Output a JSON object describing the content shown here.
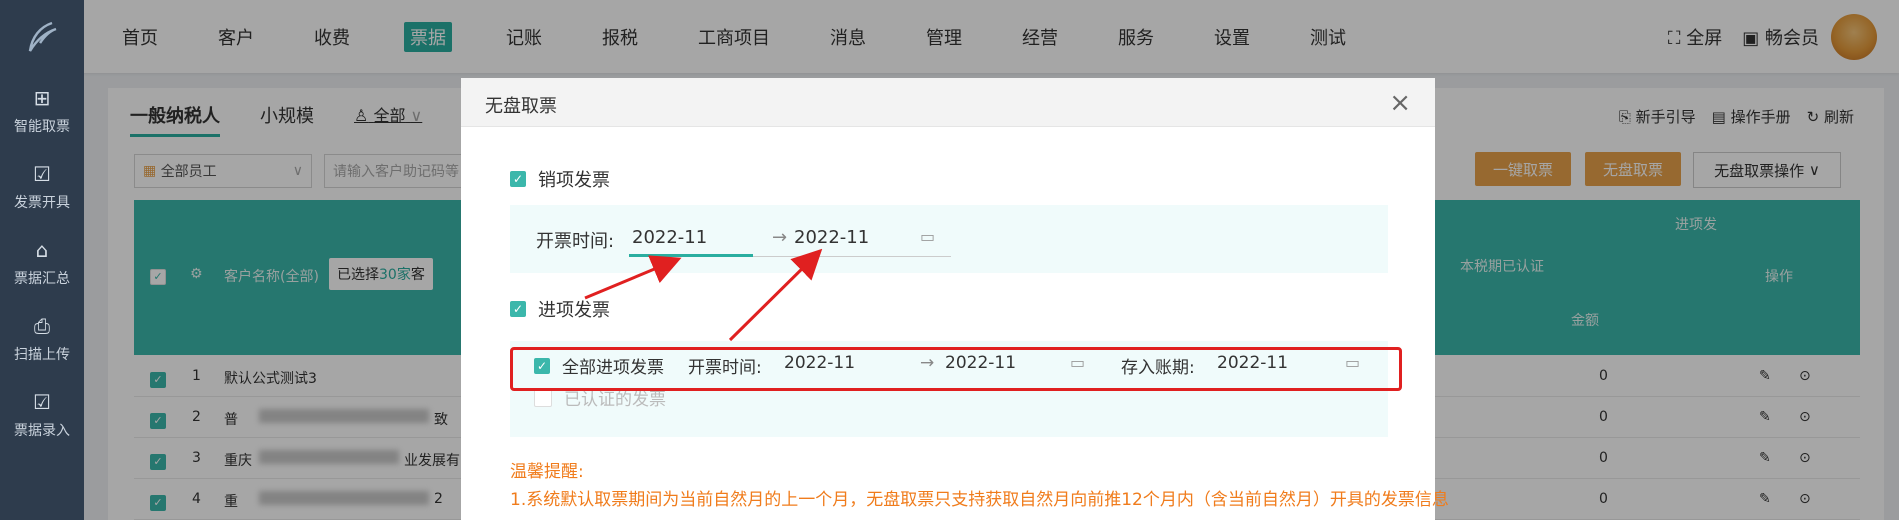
{
  "nav": {
    "items": [
      "首页",
      "客户",
      "收费",
      "票据",
      "记账",
      "报税",
      "工商项目",
      "消息",
      "管理",
      "经营",
      "服务",
      "设置",
      "测试"
    ],
    "active": "票据",
    "fullscreen": "全屏",
    "member": "畅会员"
  },
  "sidebar": {
    "items": [
      {
        "label": "智能取票",
        "icon": "smart-ticket-icon"
      },
      {
        "label": "发票开具",
        "icon": "invoice-issue-icon"
      },
      {
        "label": "票据汇总",
        "icon": "summary-icon"
      },
      {
        "label": "扫描上传",
        "icon": "scanner-icon"
      },
      {
        "label": "票据录入",
        "icon": "entry-icon"
      }
    ]
  },
  "main": {
    "tabs": [
      "一般纳税人",
      "小规模"
    ],
    "scope": "全部",
    "staff": "全部员工",
    "search_placeholder": "请输入客户助记码等",
    "links": [
      "新手引导",
      "操作手册",
      "刷新"
    ],
    "btn_one_click": "一键取票",
    "btn_no_disk": "无盘取票",
    "btn_no_disk_ops": "无盘取票操作",
    "table": {
      "col_customer": "客户名称(全部)",
      "selected_prefix": "已选择",
      "selected_count": "30家",
      "selected_suffix": "客",
      "col_input_group": "进项发",
      "col_certified": "本税期已认证",
      "col_amount": "金额",
      "col_ops": "操作",
      "rows": [
        {
          "index": "1",
          "name": "默认公式测试3",
          "amount": "0"
        },
        {
          "index": "2",
          "name": "普",
          "name_tail": "致",
          "amount": "0"
        },
        {
          "index": "3",
          "name": "重庆",
          "name_tail": "业发展有限",
          "amount": "0"
        },
        {
          "index": "4",
          "name": "重",
          "name_tail": "2",
          "amount": "0"
        }
      ]
    }
  },
  "modal": {
    "title": "无盘取票",
    "sales_label": "销项发票",
    "sales_time_label": "开票时间:",
    "sales_start": "2022-11",
    "sales_end": "2022-11",
    "input_label": "进项发票",
    "all_input_label": "全部进项发票",
    "input_time_label": "开票时间:",
    "input_start": "2022-11",
    "input_end": "2022-11",
    "account_label": "存入账期:",
    "account_period": "2022-11",
    "certified_label": "已认证的发票",
    "warn_title": "温馨提醒:",
    "warn_line1": "1.系统默认取票期间为当前自然月的上一个月，无盘取票只支持获取自然月向前推12个月内（含当前自然月）开具的发票信息"
  },
  "colors": {
    "accent": "#2aaea0",
    "table_header": "#3bb7ab",
    "orange_button": "#e9a24a",
    "warning": "#f07c1c",
    "highlight": "#e02020"
  }
}
